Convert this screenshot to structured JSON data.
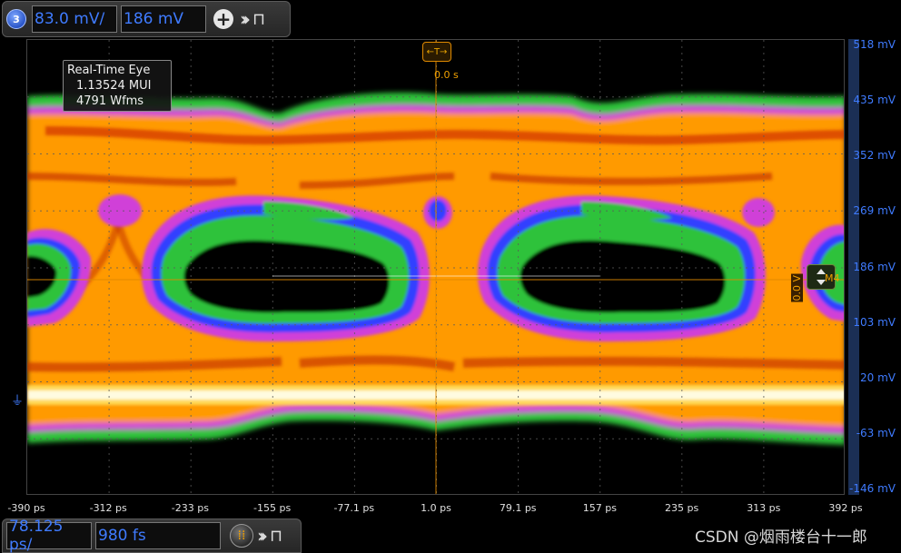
{
  "top_toolbar": {
    "channel_number": "3",
    "scale_value": "83.0 mV/",
    "offset_value": "186 mV",
    "add_icon": "plus-circle-icon",
    "expand_icon": "double-chevron-right-icon",
    "pin_icon": "pin-icon"
  },
  "bottom_toolbar": {
    "timebase_value": "78.125 ps/",
    "delay_value": "980 fs",
    "run_icon": "real-time-icon",
    "expand_icon": "double-chevron-right-icon",
    "pin_icon": "pin-icon"
  },
  "info_box": {
    "title": "Real-Time Eye",
    "ui_count": "1.13524 MUI",
    "waveforms": "4791 Wfms"
  },
  "trigger": {
    "label": "←T→",
    "time": "0.0 s"
  },
  "markers": {
    "m4": "M4",
    "level": "0.0 V"
  },
  "y_axis": {
    "labels": [
      "518 mV",
      "435 mV",
      "352 mV",
      "269 mV",
      "186 mV",
      "103 mV",
      "20 mV",
      "-63 mV",
      "-146 mV"
    ]
  },
  "x_axis": {
    "labels": [
      "-390 ps",
      "-312 ps",
      "-233 ps",
      "-155 ps",
      "-77.1 ps",
      "1.0 ps",
      "79.1 ps",
      "157 ps",
      "235 ps",
      "313 ps",
      "392 ps"
    ]
  },
  "colors": {
    "channel_blue": "#3f7bff",
    "trigger_orange": "#f0a000",
    "eye_green": "#2fc23a",
    "eye_magenta": "#e040e0",
    "eye_blue": "#3040ff",
    "eye_orange": "#ff9a00",
    "eye_red": "#d03000",
    "eye_yellow": "#ffe060"
  },
  "watermark": "CSDN @烟雨楼台十一郎"
}
